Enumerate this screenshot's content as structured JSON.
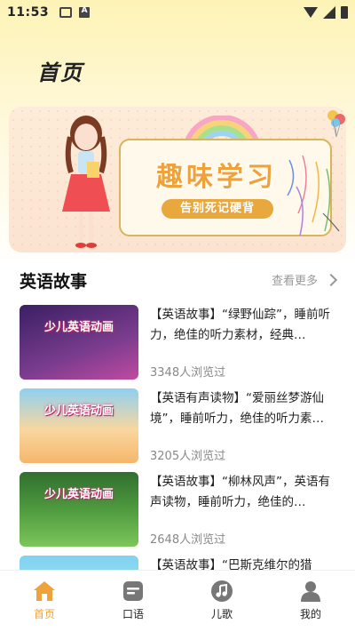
{
  "status_bar": {
    "time": "11:53"
  },
  "page": {
    "title": "首页"
  },
  "banner": {
    "title": "趣味学习",
    "subtitle": "告别死记硬背"
  },
  "section": {
    "title": "英语故事",
    "see_more": "查看更多"
  },
  "list": [
    {
      "thumb_label": "少儿英语动画",
      "thumb_colors": [
        "#3a1f63",
        "#7a3c8e"
      ],
      "title": "【英语故事】“绿野仙踪”，睡前听力，绝佳的听力素材，经典…",
      "views": "3348人浏览过"
    },
    {
      "thumb_label": "少儿英语动画",
      "thumb_colors": [
        "#8fd0f0",
        "#f6b66b"
      ],
      "title": "【英语有声读物】“爱丽丝梦游仙境”，睡前听力，绝佳的听力素…",
      "views": "3205人浏览过"
    },
    {
      "thumb_label": "少儿英语动画",
      "thumb_colors": [
        "#3a8a3a",
        "#7cc65b"
      ],
      "title": "【英语故事】“柳林风声”，英语有声读物，睡前听力，绝佳的…",
      "views": "2648人浏览过"
    },
    {
      "thumb_label": "",
      "thumb_colors": [
        "#7fd3f0",
        "#bfe9f7"
      ],
      "title": "【英语故事】“巴斯克维尔的猎",
      "views": ""
    }
  ],
  "nav": [
    {
      "label": "首页",
      "icon": "home-icon",
      "active": true
    },
    {
      "label": "口语",
      "icon": "speech-icon",
      "active": false
    },
    {
      "label": "儿歌",
      "icon": "music-note-icon",
      "active": false
    },
    {
      "label": "我的",
      "icon": "user-icon",
      "active": false
    }
  ],
  "colors": {
    "accent": "#f0a23a",
    "muted": "#888888"
  }
}
